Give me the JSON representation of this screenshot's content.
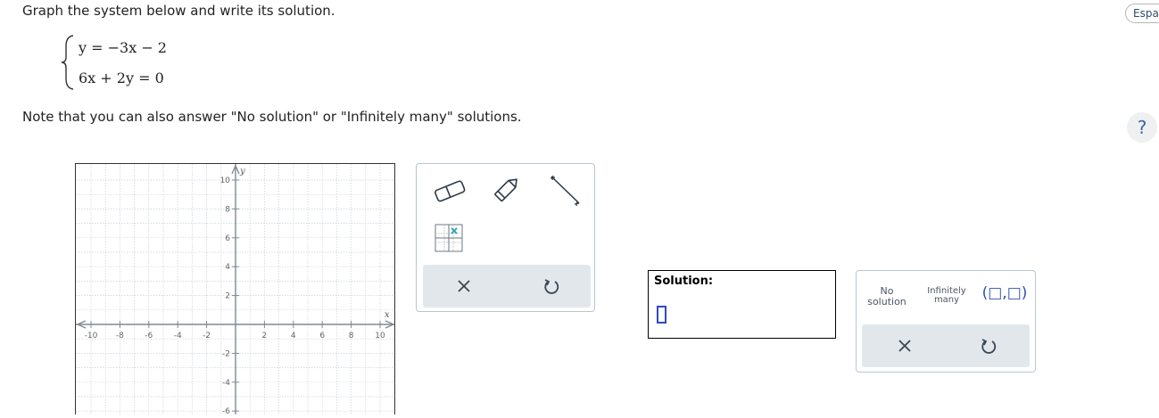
{
  "problem": {
    "instruction": "Graph the system below and write its solution.",
    "equations": [
      "y = −3x − 2",
      "6x + 2y = 0"
    ],
    "note": "Note that you can also answer \"No solution\" or \"Infinitely many\" solutions."
  },
  "header": {
    "language_button": "Espa",
    "help_button": "?"
  },
  "graph": {
    "x_axis_label": "x",
    "y_axis_label": "y",
    "x_ticks": [
      "-10",
      "-8",
      "-6",
      "-4",
      "-2",
      "2",
      "4",
      "6",
      "8",
      "10"
    ],
    "y_ticks": [
      "10",
      "8",
      "6",
      "4",
      "2",
      "-2",
      "-4",
      "-6"
    ],
    "x_range": [
      -10,
      10
    ],
    "y_range": [
      -10,
      10
    ],
    "grid": true
  },
  "graph_tools": {
    "tools": [
      "eraser-icon",
      "pencil-icon",
      "line-segment-icon",
      "point-grid-icon"
    ],
    "actions": [
      "close-icon",
      "undo-icon"
    ]
  },
  "solution": {
    "label": "Solution:"
  },
  "keypad": {
    "no_solution": "No solution",
    "infinitely_many": "Infinitely many",
    "ordered_pair": "(□,□)",
    "actions": [
      "close-icon",
      "undo-icon"
    ]
  },
  "colors": {
    "slot_border": "#3048c8",
    "action_bar": "#e2e7eb",
    "panel_border": "#b8c6d4"
  }
}
